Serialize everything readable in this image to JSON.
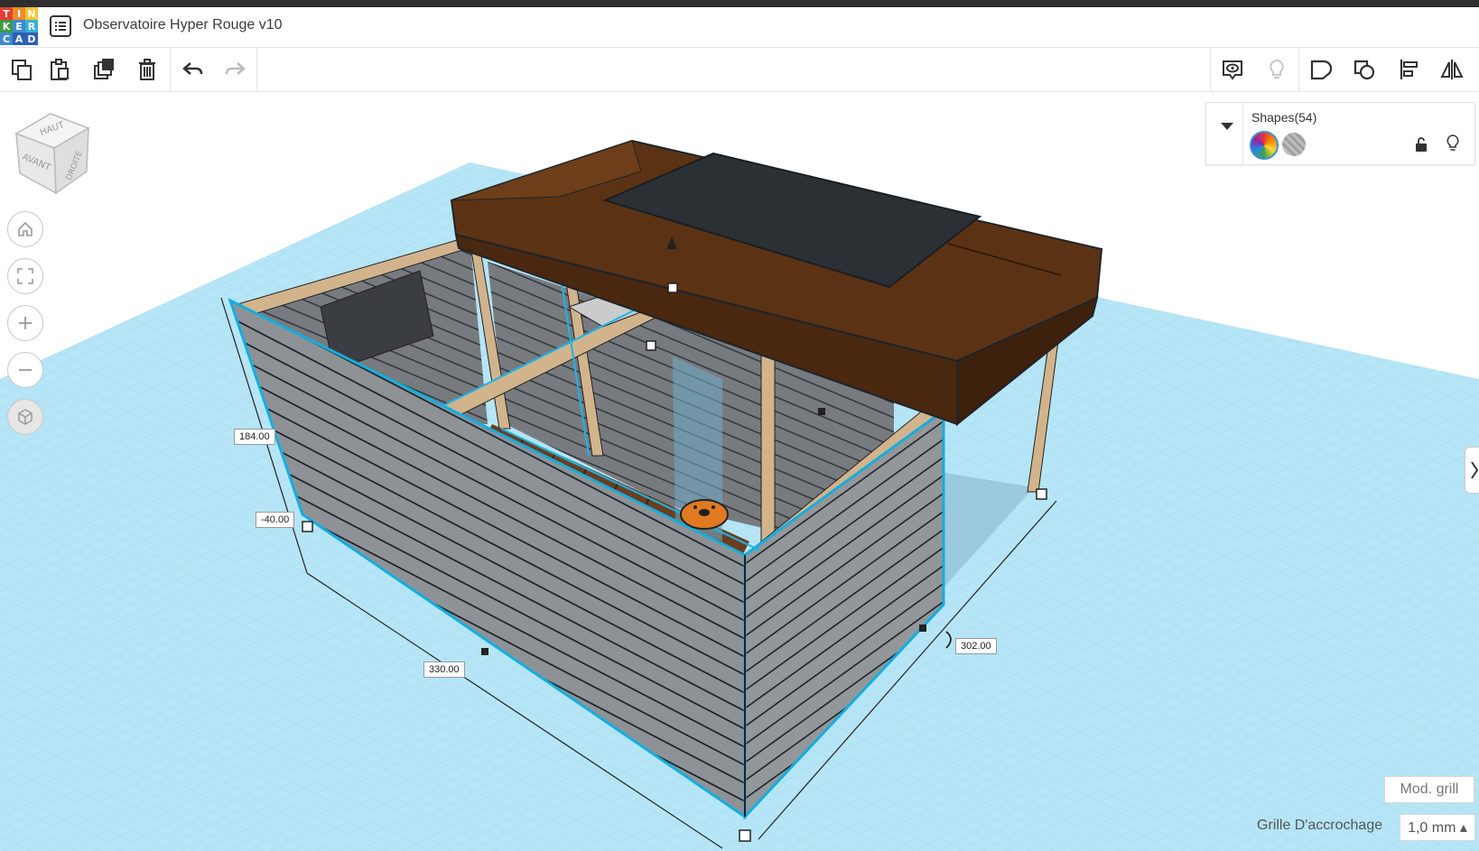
{
  "app": {
    "logo_letters": [
      "T",
      "I",
      "N",
      "K",
      "E",
      "R",
      "C",
      "A",
      "D"
    ],
    "logo_colors": [
      "#e63d2e",
      "#f08a2c",
      "#f6c533",
      "#3f9b44",
      "#3e8ad0",
      "#36b2d9",
      "#3e8ad0",
      "#2d5fb3",
      "#2d5fb3"
    ],
    "title": "Observatoire Hyper Rouge v10"
  },
  "toolbar": {
    "left_icons": [
      "copy-icon",
      "paste-icon",
      "duplicate-icon",
      "delete-icon",
      "undo-icon",
      "redo-icon"
    ],
    "right_icons": [
      "notes-icon",
      "light-bulb-icon",
      "group-icon",
      "ungroup-icon",
      "align-icon",
      "mirror-icon"
    ]
  },
  "viewcube": {
    "top": "HAUT",
    "front": "AVANT",
    "right": "DROITE"
  },
  "nav": [
    "home-view-icon",
    "fit-view-icon",
    "zoom-in-icon",
    "zoom-out-icon",
    "perspective-icon"
  ],
  "shapes_panel": {
    "title": "Shapes(54)",
    "colors": {
      "solid": "rainbow",
      "hole": "striped"
    }
  },
  "dimensions": {
    "height": "184.00",
    "elevation": "-40.00",
    "length": "330.00",
    "width": "302.00"
  },
  "bottom": {
    "grid_button": "Mod. grill",
    "snap_label": "Grille D'accrochage",
    "snap_value": "1,0 mm ▴"
  },
  "colors": {
    "grid_blue": "#b3e4f5",
    "selection": "#19b6e8",
    "wall_gray": "#8d9195",
    "roof_brown": "#5b3314",
    "beam_tan": "#d2b48c",
    "panel_dark": "#2b3035"
  }
}
